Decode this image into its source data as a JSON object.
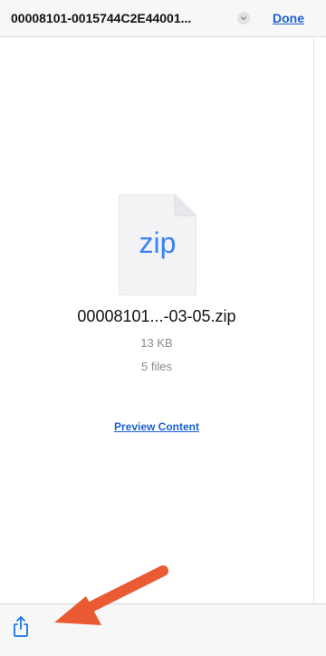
{
  "header": {
    "title": "00008101-0015744C2E44001...",
    "done_label": "Done"
  },
  "file": {
    "icon_ext": "zip",
    "name": "00008101...-03-05.zip",
    "size": "13 KB",
    "count": "5 files"
  },
  "actions": {
    "preview_label": "Preview Content"
  },
  "toolbar": {
    "share_icon": "share-icon"
  },
  "annotation": {
    "arrow_color": "#ea5a33"
  }
}
